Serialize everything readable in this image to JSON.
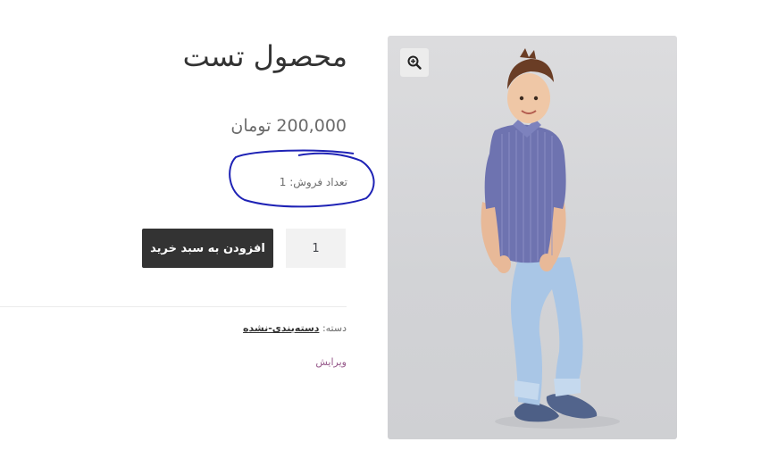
{
  "product": {
    "title": "محصول تست",
    "price": "200,000 تومان",
    "sales_count": "تعداد فروش: 1",
    "quantity": "1",
    "add_to_cart_label": "افزودن به سبد خرید",
    "category_label": "دسته:",
    "category_value": "دسته‌بندی-نشده",
    "edit_label": "ویرایش"
  },
  "icons": {
    "zoom": "zoom-in-icon"
  },
  "colors": {
    "button_bg": "#333333",
    "annotation": "#1e22b5",
    "edit_link": "#96588a"
  }
}
